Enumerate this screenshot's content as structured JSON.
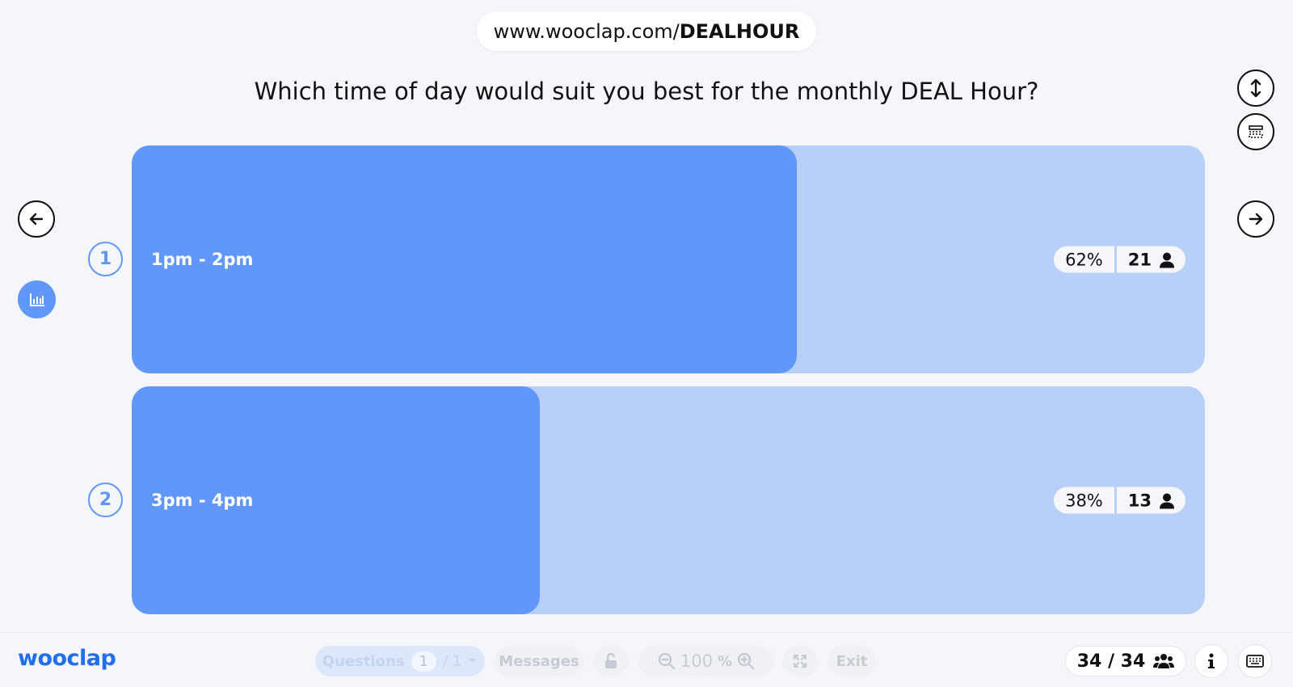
{
  "header": {
    "url_prefix": "www.wooclap.com/",
    "url_code": "DEALHOUR",
    "question": "Which time of day would suit you best for the monthly DEAL Hour?"
  },
  "answers": [
    {
      "number": "1",
      "label": "1pm - 2pm",
      "percent_text": "62%",
      "percent": 62,
      "count": "21"
    },
    {
      "number": "2",
      "label": "3pm - 4pm",
      "percent_text": "38%",
      "percent": 38,
      "count": "13"
    }
  ],
  "footer": {
    "logo": "wooclap",
    "questions_label": "Questions",
    "questions_current": "1",
    "questions_total": "/ 1",
    "messages_label": "Messages",
    "zoom_value": "100",
    "zoom_unit": "%",
    "exit_label": "Exit",
    "participants": "34 / 34"
  },
  "colors": {
    "bar_fill": "#6197f8",
    "bar_track": "#b8cff8",
    "brand": "#1f6ff0"
  },
  "icons": [
    "arrow-left-icon",
    "arrow-right-icon",
    "vertical-resize-icon",
    "grid-layout-icon",
    "bar-chart-icon",
    "user-icon",
    "users-icon",
    "lock-open-icon",
    "zoom-out-icon",
    "zoom-in-icon",
    "fullscreen-icon",
    "info-icon",
    "keyboard-icon",
    "caret-down-icon"
  ]
}
